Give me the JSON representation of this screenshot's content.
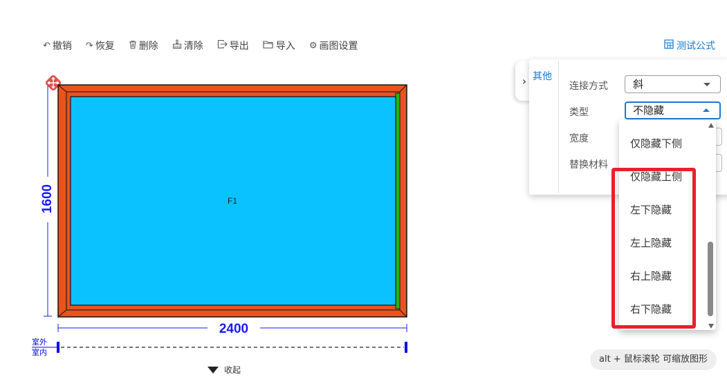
{
  "toolbar": {
    "undo": {
      "label": "撤销",
      "icon": "undo-icon"
    },
    "redo": {
      "label": "恢复",
      "icon": "redo-icon"
    },
    "delete": {
      "label": "删除",
      "icon": "trash-icon"
    },
    "clear": {
      "label": "清除",
      "icon": "broom-icon"
    },
    "export": {
      "label": "导出",
      "icon": "export-icon"
    },
    "import": {
      "label": "导入",
      "icon": "folder-icon"
    },
    "settings": {
      "label": "画图设置",
      "icon": "gear-icon"
    },
    "formula": {
      "label": "测试公式",
      "icon": "calculator-icon"
    }
  },
  "drawing": {
    "panel_label": "F1",
    "width_dim": "2400",
    "height_dim": "1600",
    "outside_label": "室外",
    "inside_label": "室内",
    "colors": {
      "frame": "#e8531e",
      "glass": "#09c2ff",
      "sash_edge": "#22b414",
      "dimension": "#1a1aff"
    }
  },
  "collapse_label": "收起",
  "panel": {
    "tab": "其他",
    "fields": {
      "connection": {
        "label": "连接方式",
        "value": "斜"
      },
      "type": {
        "label": "类型",
        "value": "不隐藏"
      },
      "width": {
        "label": "宽度"
      },
      "material": {
        "label": "替换材料"
      }
    }
  },
  "dropdown": {
    "options": [
      "仅隐藏下侧",
      "仅隐藏上侧",
      "左下隐藏",
      "左上隐藏",
      "右上隐藏",
      "右下隐藏"
    ],
    "highlight_color": "#e8202a"
  },
  "hint": "alt + 鼠标滚轮 可缩放图形"
}
